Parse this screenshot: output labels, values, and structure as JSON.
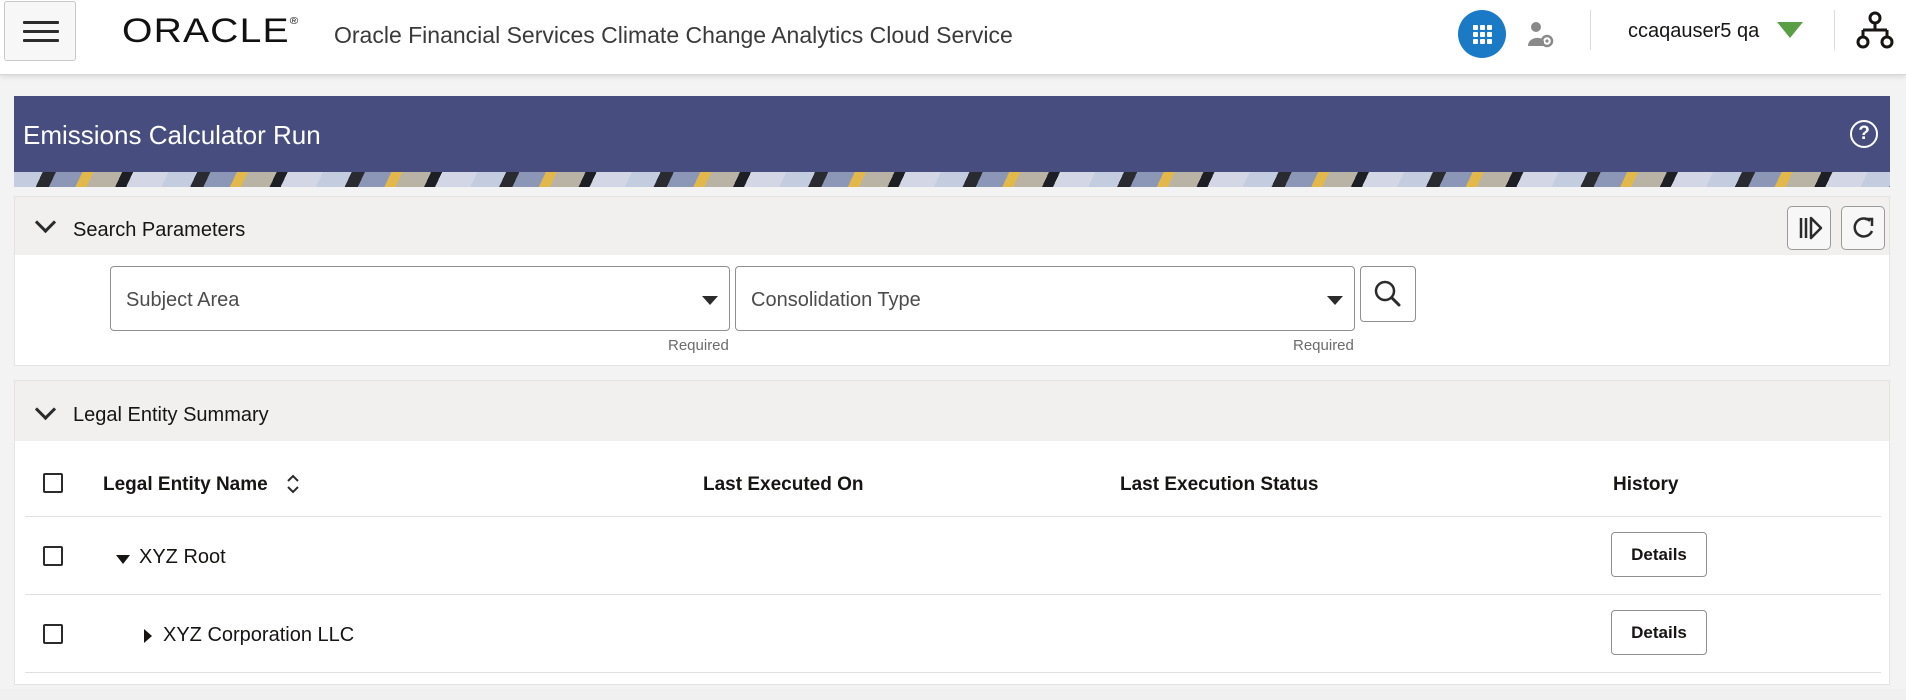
{
  "header": {
    "logo_text": "ORACLE",
    "logo_reg": "®",
    "app_title": "Oracle Financial Services Climate Change Analytics Cloud Service",
    "username": "ccaqauser5 qa",
    "icons": [
      "hamburger-menu-icon",
      "apps-grid-icon",
      "user-gear-icon",
      "user-menu-caret-icon",
      "hierarchy-icon"
    ],
    "accent_color": "#1a7ac6"
  },
  "banner": {
    "title": "Emissions Calculator Run",
    "help_symbol": "?",
    "color": "#474e7f"
  },
  "search": {
    "title": "Search Parameters",
    "subject_area": {
      "label": "Subject Area",
      "helper": "Required"
    },
    "consolidation_type": {
      "label": "Consolidation Type",
      "helper": "Required"
    },
    "icons": [
      "search-icon",
      "run-icon",
      "reset-icon"
    ]
  },
  "summary": {
    "title": "Legal Entity Summary",
    "columns": {
      "name": "Legal Entity Name",
      "last_executed": "Last Executed On",
      "last_status": "Last Execution Status",
      "history": "History"
    },
    "rows": [
      {
        "name": "XYZ Root",
        "expanded": true,
        "action": "Details"
      },
      {
        "name": "XYZ Corporation LLC",
        "expanded": false,
        "action": "Details"
      }
    ]
  }
}
